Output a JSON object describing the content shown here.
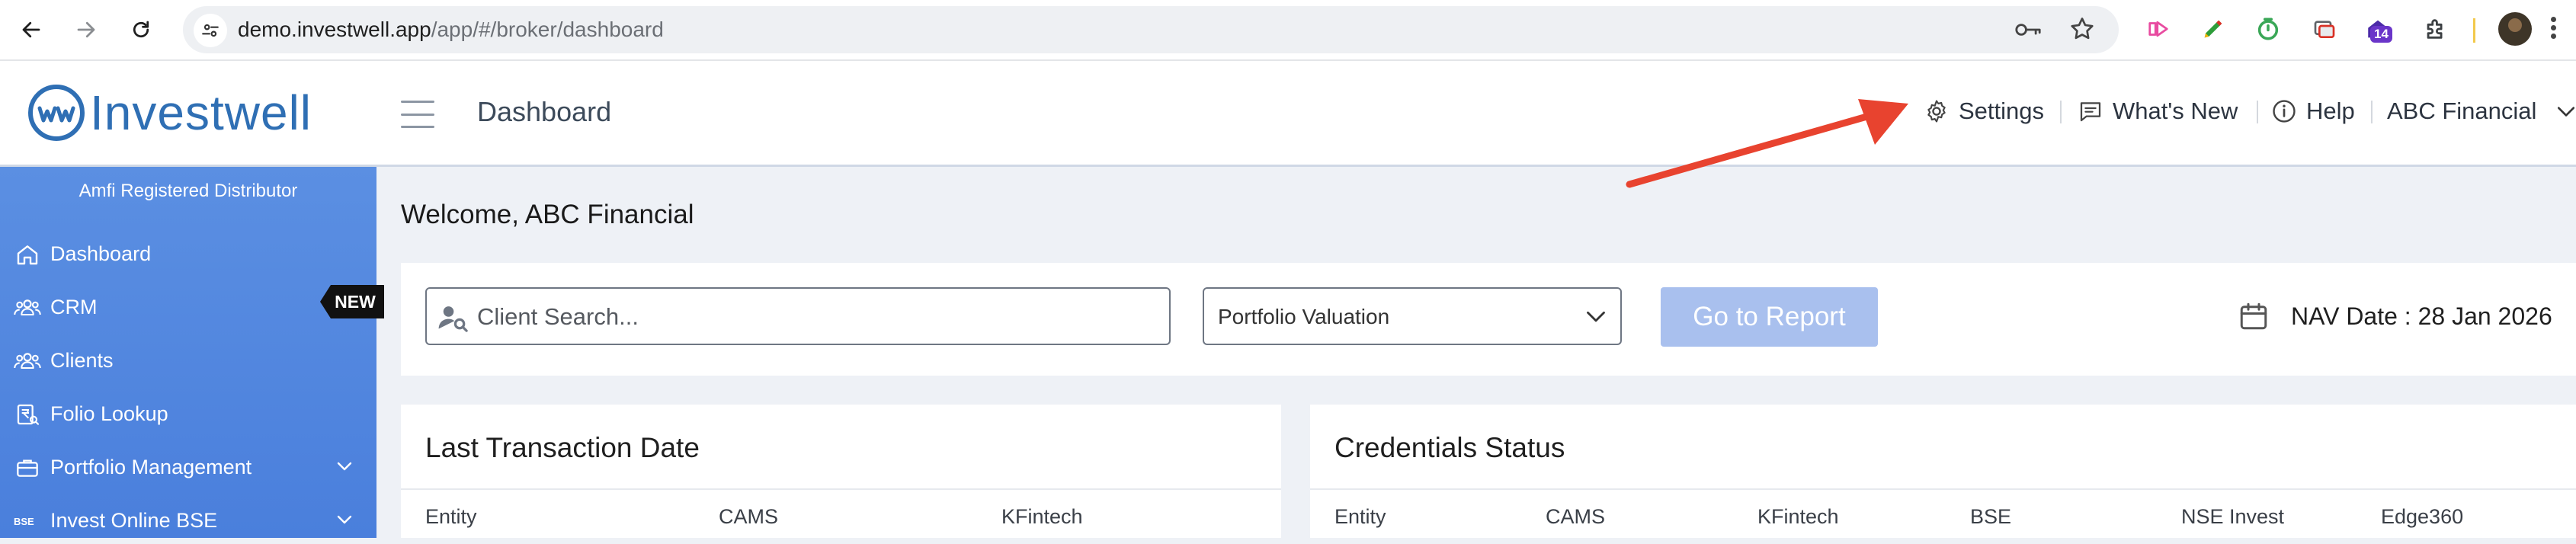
{
  "browser": {
    "url_host": "demo.investwell.app",
    "url_path": "/app/#/broker/dashboard",
    "extension_badge": "14"
  },
  "app": {
    "logo_text": "Investwell",
    "page_title": "Dashboard",
    "header": {
      "settings": "Settings",
      "whats_new": "What's New",
      "help": "Help",
      "account": "ABC Financial"
    }
  },
  "sidebar": {
    "heading": "Amfi Registered Distributor",
    "new_tag": "NEW",
    "items": [
      {
        "label": "Dashboard",
        "icon": "home-icon"
      },
      {
        "label": "CRM",
        "icon": "users-icon"
      },
      {
        "label": "Clients",
        "icon": "users-icon"
      },
      {
        "label": "Folio Lookup",
        "icon": "rupee-doc-icon"
      },
      {
        "label": "Portfolio Management",
        "icon": "briefcase-icon"
      },
      {
        "label": "Invest Online BSE",
        "icon": "bse-logo-icon"
      }
    ]
  },
  "main": {
    "welcome": "Welcome, ABC Financial",
    "search": {
      "placeholder": "Client Search...",
      "report_select": "Portfolio Valuation",
      "go_button": "Go to Report",
      "nav_date": "NAV Date : 28 Jan 2026"
    },
    "last_transaction": {
      "title": "Last Transaction Date",
      "columns": [
        "Entity",
        "CAMS",
        "KFintech"
      ]
    },
    "credentials": {
      "title": "Credentials Status",
      "columns": [
        "Entity",
        "CAMS",
        "KFintech",
        "BSE",
        "NSE Invest",
        "Edge360"
      ]
    }
  },
  "colors": {
    "brand": "#2f6fb4",
    "sidebar": "#5b8fe2",
    "button_disabled": "#a9c0ee",
    "annotation_arrow": "#e8432f"
  }
}
